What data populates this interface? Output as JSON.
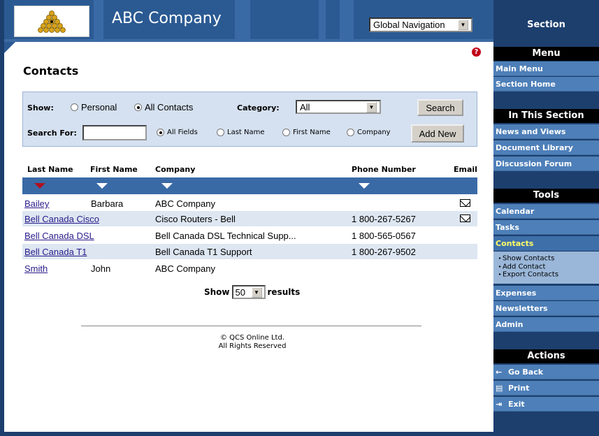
{
  "header": {
    "company": "ABC Company",
    "global_nav": "Global Navigation",
    "help_icon": "help-icon"
  },
  "page": {
    "title": "Contacts"
  },
  "search": {
    "show_label": "Show:",
    "show_options": [
      "Personal",
      "All Contacts"
    ],
    "show_selected": "All Contacts",
    "category_label": "Category:",
    "category_value": "All",
    "search_button": "Search",
    "search_for_label": "Search For:",
    "search_value": "",
    "field_options": [
      "All Fields",
      "Last Name",
      "First Name",
      "Company"
    ],
    "field_selected": "All Fields",
    "add_new_button": "Add New"
  },
  "table": {
    "headers": [
      "Last Name",
      "First Name",
      "Company",
      "Phone Number",
      "Email"
    ],
    "rows": [
      {
        "last": "Bailey",
        "first": "Barbara",
        "company": "ABC Company",
        "phone": "",
        "email": true
      },
      {
        "last": "Bell Canada Cisco",
        "first": "",
        "company": "Cisco Routers - Bell",
        "phone": "1 800-267-5267",
        "email": true
      },
      {
        "last": "Bell Canada DSL",
        "first": "",
        "company": "Bell Canada DSL Technical Supp...",
        "phone": "1 800-565-0567",
        "email": false
      },
      {
        "last": "Bell Canada T1",
        "first": "",
        "company": "Bell Canada T1 Support",
        "phone": "1 800-267-9502",
        "email": false
      },
      {
        "last": "Smith",
        "first": "John",
        "company": "ABC Company",
        "phone": "",
        "email": false
      }
    ]
  },
  "pager": {
    "show_label": "Show",
    "count": "50",
    "results_label": "results"
  },
  "footer": {
    "line1": "© QCS Online Ltd.",
    "line2": "All Rights Reserved"
  },
  "sidebar": {
    "section_title": "Section",
    "menu_title": "Menu",
    "menu_items": [
      "Main Menu",
      "Section Home"
    ],
    "in_section_title": "In This Section",
    "in_section_items": [
      "News and Views",
      "Document Library",
      "Discussion Forum"
    ],
    "tools_title": "Tools",
    "tools_items": [
      "Calendar",
      "Tasks",
      "Contacts"
    ],
    "contacts_sub": [
      "Show Contacts",
      "Add Contact",
      "Export Contacts"
    ],
    "tools_items_2": [
      "Expenses",
      "Newsletters",
      "Admin"
    ],
    "actions_title": "Actions",
    "actions": [
      {
        "label": "Go Back",
        "icon": "back-arrow-icon"
      },
      {
        "label": "Print",
        "icon": "print-icon"
      },
      {
        "label": "Exit",
        "icon": "exit-icon"
      }
    ]
  },
  "colors": {
    "header_blue": "#2b5a93",
    "sidebar_blue": "#1d3f6e",
    "item_blue": "#4e7fb8",
    "active_yellow": "#ffff66",
    "sort_red": "#b01020"
  }
}
